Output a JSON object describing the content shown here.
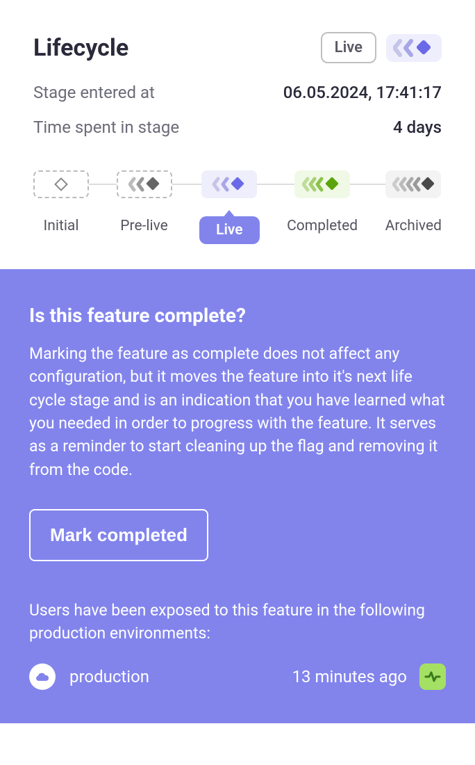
{
  "header": {
    "title": "Lifecycle",
    "live_badge": "Live"
  },
  "info": {
    "stage_entered_label": "Stage entered at",
    "stage_entered_value": "06.05.2024, 17:41:17",
    "time_spent_label": "Time spent in stage",
    "time_spent_value": "4 days"
  },
  "stages": {
    "initial": "Initial",
    "prelive": "Pre-live",
    "live": "Live",
    "completed": "Completed",
    "archived": "Archived"
  },
  "purple": {
    "heading": "Is this feature complete?",
    "body": "Marking the feature as complete does not affect any configuration, but it moves the feature into it's next life cycle stage and is an indication that you have learned what you needed in order to progress with the feature. It serves as a reminder to start cleaning up the flag and removing it from the code.",
    "mark_btn": "Mark completed",
    "exposed_text": "Users have been exposed to this feature in the following production environments:",
    "env_name": "production",
    "env_time": "13 minutes ago"
  }
}
